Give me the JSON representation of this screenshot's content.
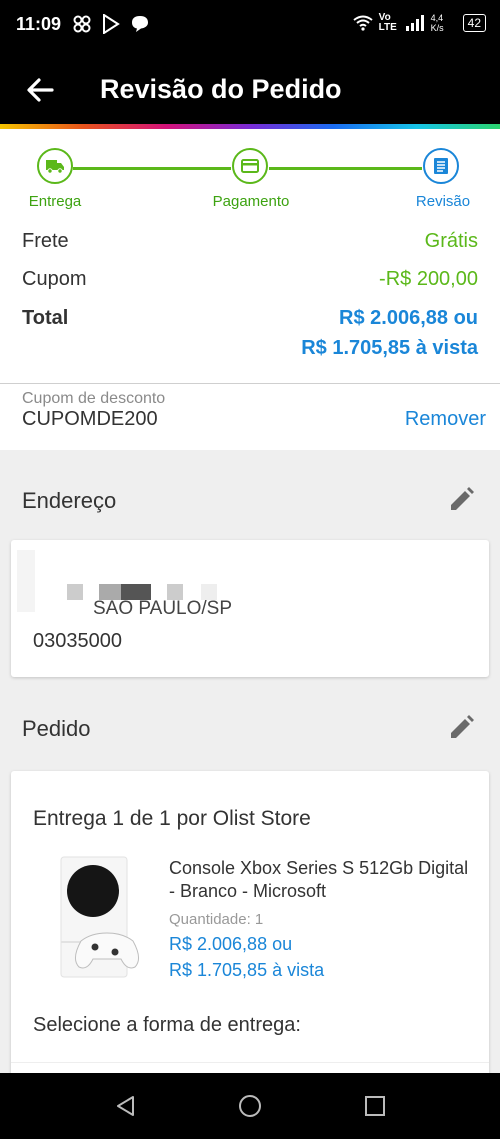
{
  "status": {
    "time": "11:09",
    "net1": "Vo LTE",
    "speed": "4,4 K/s",
    "battery": "42"
  },
  "header": {
    "title": "Revisão do Pedido"
  },
  "steps": [
    {
      "label": "Entrega",
      "icon": "truck-icon"
    },
    {
      "label": "Pagamento",
      "icon": "card-icon"
    },
    {
      "label": "Revisão",
      "icon": "list-icon"
    }
  ],
  "summary": {
    "frete_label": "Frete",
    "frete_value": "Grátis",
    "cupom_label": "Cupom",
    "cupom_value": "-R$ 200,00",
    "total_label": "Total",
    "total_value": "R$ 2.006,88 ou",
    "total_vista": "R$ 1.705,85 à vista"
  },
  "coupon": {
    "label": "Cupom de desconto",
    "code": "CUPOMDE200",
    "remove": "Remover"
  },
  "address": {
    "title": "Endereço",
    "city": "SAO PAULO/SP",
    "cep": "03035000"
  },
  "order": {
    "title": "Pedido",
    "delivery": "Entrega 1 de 1 por Olist Store",
    "product": "Console Xbox Series S 512Gb Digital - Branco - Microsoft",
    "quantity": "Quantidade:  1",
    "price": "R$ 2.006,88 ou",
    "price_vista": "R$ 1.705,85 à vista",
    "shipping_prompt": "Selecione a forma de entrega:"
  },
  "colors": {
    "green": "#5bb81a",
    "blue": "#1a86d8"
  }
}
